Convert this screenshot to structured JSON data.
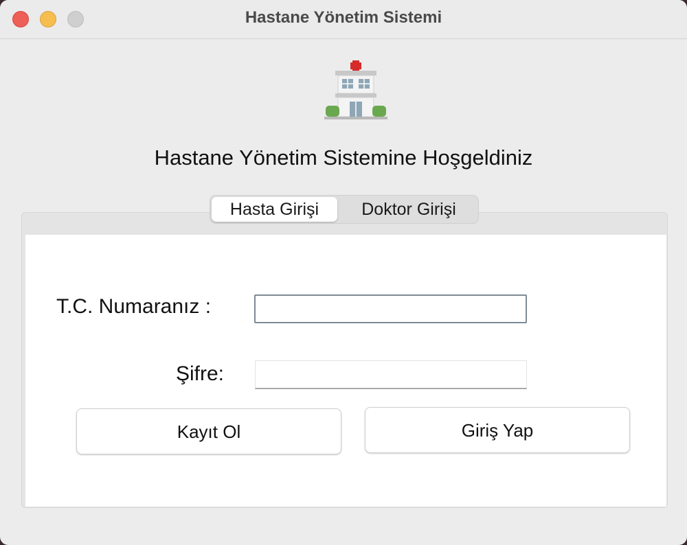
{
  "window": {
    "title": "Hastane Yönetim Sistemi"
  },
  "header": {
    "logo_icon": "hospital-icon",
    "welcome": "Hastane Yönetim Sistemine Hoşgeldiniz"
  },
  "tabs": [
    {
      "label": "Hasta Girişi",
      "active": true
    },
    {
      "label": "Doktor Girişi",
      "active": false
    }
  ],
  "form": {
    "tc_label": "T.C. Numaranız :",
    "tc_value": "",
    "password_label": "Şifre:",
    "password_value": "",
    "register_button": "Kayıt Ol",
    "login_button": "Giriş Yap"
  },
  "colors": {
    "close": "#ee5f57",
    "minimize": "#f5be4f",
    "zoom": "#cfcfcf",
    "cross": "#d62b2b"
  }
}
